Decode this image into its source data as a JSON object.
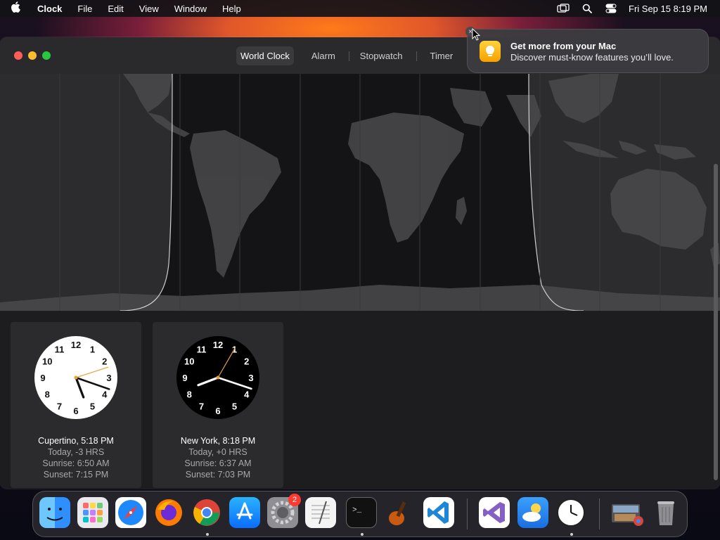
{
  "menubar": {
    "app_name": "Clock",
    "menus": [
      "File",
      "Edit",
      "View",
      "Window",
      "Help"
    ],
    "datetime": "Fri Sep 15  8:19 PM"
  },
  "window": {
    "tabs": [
      {
        "label": "World Clock",
        "active": true
      },
      {
        "label": "Alarm",
        "active": false
      },
      {
        "label": "Stopwatch",
        "active": false
      },
      {
        "label": "Timer",
        "active": false
      }
    ]
  },
  "clocks": [
    {
      "city": "Cupertino, 5:18 PM",
      "offset": "Today, -3 HRS",
      "sunrise": "Sunrise: 6:50 AM",
      "sunset": "Sunset: 7:15 PM",
      "theme": "light",
      "time": {
        "h": 5,
        "m": 18,
        "s": 12
      }
    },
    {
      "city": "New York, 8:18 PM",
      "offset": "Today, +0 HRS",
      "sunrise": "Sunrise: 6:37 AM",
      "sunset": "Sunset: 7:03 PM",
      "theme": "dark",
      "time": {
        "h": 8,
        "m": 18,
        "s": 5
      }
    }
  ],
  "clock_numerals": [
    "12",
    "1",
    "2",
    "3",
    "4",
    "5",
    "6",
    "7",
    "8",
    "9",
    "10",
    "11"
  ],
  "notification": {
    "title": "Get more from your Mac",
    "body": "Discover must-know features you’ll love.",
    "close_glyph": "×"
  },
  "dock": {
    "apps": [
      "Finder",
      "Launchpad",
      "Safari",
      "Firefox",
      "Chrome",
      "App Store",
      "System Settings",
      "TextEdit",
      "Terminal",
      "GarageBand",
      "Visual Studio Code",
      "Visual Studio",
      "Weather",
      "Clock",
      "Downloads",
      "Trash"
    ],
    "system_settings_badge": "2"
  },
  "colors": {
    "accent_orange": "#e8a33a",
    "map_land": "#4a4a4c",
    "map_night": "#141416",
    "map_day": "#2c2c2e"
  }
}
